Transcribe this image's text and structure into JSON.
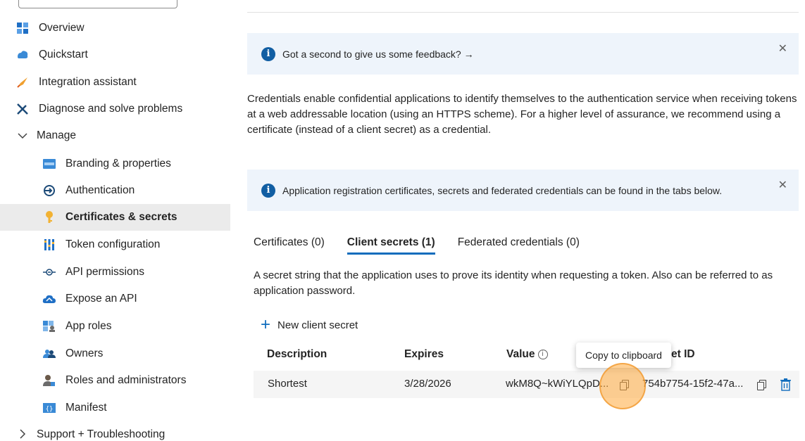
{
  "sidebar": {
    "items": [
      {
        "label": "Overview",
        "icon": "overview-icon"
      },
      {
        "label": "Quickstart",
        "icon": "quickstart-icon"
      },
      {
        "label": "Integration assistant",
        "icon": "rocket-icon"
      },
      {
        "label": "Diagnose and solve problems",
        "icon": "wrench-icon"
      },
      {
        "label": "Manage",
        "icon": "chevron-down-icon"
      },
      {
        "label": "Branding & properties",
        "icon": "branding-icon"
      },
      {
        "label": "Authentication",
        "icon": "authentication-icon"
      },
      {
        "label": "Certificates & secrets",
        "icon": "key-icon"
      },
      {
        "label": "Token configuration",
        "icon": "token-icon"
      },
      {
        "label": "API permissions",
        "icon": "api-permissions-icon"
      },
      {
        "label": "Expose an API",
        "icon": "cloud-icon"
      },
      {
        "label": "App roles",
        "icon": "app-roles-icon"
      },
      {
        "label": "Owners",
        "icon": "owners-icon"
      },
      {
        "label": "Roles and administrators",
        "icon": "roles-icon"
      },
      {
        "label": "Manifest",
        "icon": "manifest-icon"
      },
      {
        "label": "Support + Troubleshooting",
        "icon": "chevron-right-icon"
      }
    ]
  },
  "feedback_banner": {
    "text": "Got a second to give us some feedback? →"
  },
  "intro": "Credentials enable confidential applications to identify themselves to the authentication service when receiving tokens at a web addressable location (using an HTTPS scheme). For a higher level of assurance, we recommend using a certificate (instead of a client secret) as a credential.",
  "info_banner": {
    "text": "Application registration certificates, secrets and federated credentials can be found in the tabs below."
  },
  "tabs": [
    {
      "label": "Certificates (0)"
    },
    {
      "label": "Client secrets (1)"
    },
    {
      "label": "Federated credentials (0)"
    }
  ],
  "secrets_description": "A secret string that the application uses to prove its identity when requesting a token. Also can be referred to as application password.",
  "new_secret_label": "New client secret",
  "table": {
    "headers": {
      "description": "Description",
      "expires": "Expires",
      "value": "Value",
      "secret_id": "et ID"
    },
    "rows": [
      {
        "description": "Shortest",
        "expires": "3/28/2026",
        "value": "wkM8Q~kWiYLQpD...",
        "secret_id": "754b7754-15f2-47a..."
      }
    ]
  },
  "tooltip": "Copy to clipboard",
  "colors": {
    "accent": "#0f6cbd",
    "banner_bg": "#eef4fb",
    "selected_bg": "#ebebeb"
  }
}
